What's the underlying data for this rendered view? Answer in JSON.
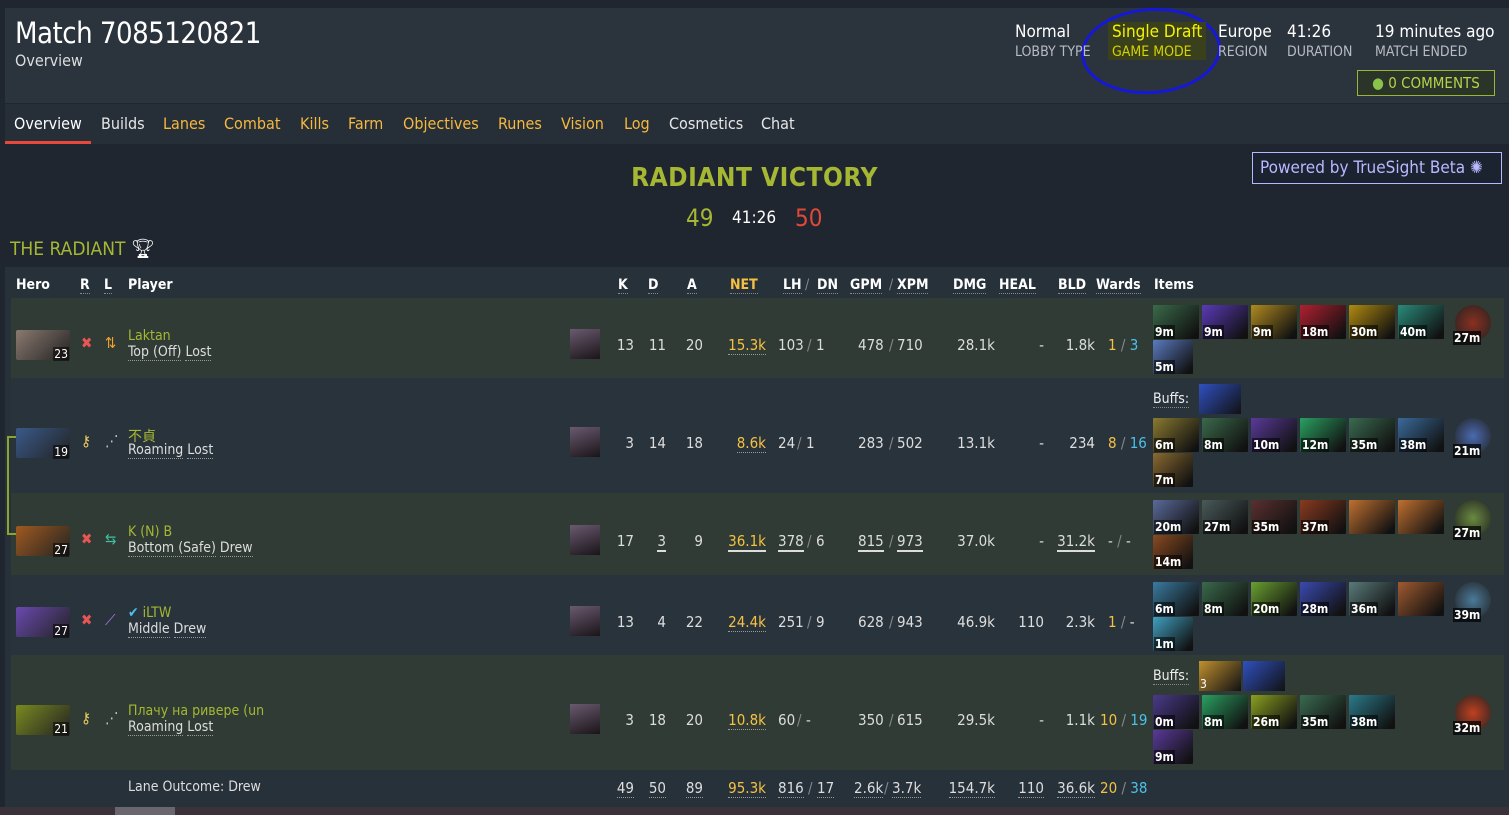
{
  "header": {
    "title": "Match 7085120821",
    "subtitle": "Overview",
    "meta": [
      {
        "value": "Normal",
        "label": "LOBBY TYPE"
      },
      {
        "value": "Single Draft",
        "label": "GAME MODE",
        "highlighted": true
      },
      {
        "value": "Europe",
        "label": "REGION"
      },
      {
        "value": "41:26",
        "label": "DURATION"
      },
      {
        "value": "19 minutes ago",
        "label": "MATCH ENDED"
      }
    ],
    "comments": "0 COMMENTS",
    "annotation_color": "#1518d8"
  },
  "tabs": [
    {
      "label": "Overview",
      "active": true
    },
    {
      "label": "Builds"
    },
    {
      "label": "Lanes"
    },
    {
      "label": "Combat"
    },
    {
      "label": "Kills"
    },
    {
      "label": "Farm"
    },
    {
      "label": "Objectives"
    },
    {
      "label": "Runes"
    },
    {
      "label": "Vision"
    },
    {
      "label": "Log"
    },
    {
      "label": "Cosmetics"
    },
    {
      "label": "Chat"
    }
  ],
  "truesight": "Powered by TrueSight Beta",
  "result": {
    "title": "RADIANT VICTORY",
    "radiant_score": "49",
    "duration": "41:26",
    "dire_score": "50"
  },
  "team": {
    "name": "THE RADIANT",
    "icon": "trophy-icon"
  },
  "columns": {
    "hero": "Hero",
    "r": "R",
    "l": "L",
    "player": "Player",
    "k": "K",
    "d": "D",
    "a": "A",
    "net": "NET",
    "lh": "LH",
    "dn": "DN",
    "gpm": "GPM",
    "xpm": "XPM",
    "dmg": "DMG",
    "heal": "HEAL",
    "bld": "BLD",
    "wards": "Wards",
    "items": "Items",
    "sep": "/"
  },
  "buffs_label": "Buffs:",
  "players": [
    {
      "level": "23",
      "hero_color": "#8a7a70",
      "role": "core",
      "lane_icon": "top-off",
      "name": "Laktan",
      "lane": "Top (Off)",
      "outcome": "Lost",
      "k": "13",
      "d": "11",
      "a": "20",
      "net": "15.3k",
      "lh": "103",
      "dn": "1",
      "gpm": "478",
      "xpm": "710",
      "dmg": "28.1k",
      "heal": "-",
      "bld": "1.8k",
      "obs": "1",
      "sen": "3",
      "best": [],
      "items": [
        {
          "t": "9m",
          "c": "#3a6a4a"
        },
        {
          "t": "9m",
          "c": "#5a3ab8"
        },
        {
          "t": "9m",
          "c": "#b08a20"
        },
        {
          "t": "18m",
          "c": "#b02030"
        },
        {
          "t": "30m",
          "c": "#b08a10"
        },
        {
          "t": "40m",
          "c": "#2a8a7a"
        }
      ],
      "neutral": {
        "t": "27m",
        "c": "#8a3020"
      },
      "extra": [
        {
          "t": "5m",
          "c": "#5a7ac0"
        }
      ],
      "buffs": []
    },
    {
      "level": "19",
      "hero_color": "#3a5a8a",
      "role": "support",
      "lane_icon": "roaming",
      "name": "不貞",
      "lane": "Roaming",
      "outcome": "Lost",
      "k": "3",
      "d": "14",
      "a": "18",
      "net": "8.6k",
      "lh": "24",
      "dn": "1",
      "gpm": "283",
      "xpm": "502",
      "dmg": "13.1k",
      "heal": "-",
      "bld": "234",
      "obs": "8",
      "sen": "16",
      "best": [],
      "items": [
        {
          "t": "6m",
          "c": "#8a7a30"
        },
        {
          "t": "8m",
          "c": "#3a6a4a"
        },
        {
          "t": "10m",
          "c": "#5a3a9a"
        },
        {
          "t": "12m",
          "c": "#2aa060"
        },
        {
          "t": "35m",
          "c": "#3a6a50"
        },
        {
          "t": "38m",
          "c": "#3a6a9a"
        }
      ],
      "neutral": {
        "t": "21m",
        "c": "#4a6ab0"
      },
      "extra": [
        {
          "t": "7m",
          "c": "#8a6a30"
        }
      ],
      "buffs": [
        {
          "t": "",
          "c": "#3050c0"
        }
      ]
    },
    {
      "level": "27",
      "hero_color": "#a05a20",
      "role": "core",
      "lane_icon": "bottom-safe",
      "name": "K (N) B",
      "lane": "Bottom (Safe)",
      "outcome": "Drew",
      "k": "17",
      "d": "3",
      "a": "9",
      "net": "36.1k",
      "lh": "378",
      "dn": "6",
      "gpm": "815",
      "xpm": "973",
      "dmg": "37.0k",
      "heal": "-",
      "bld": "31.2k",
      "obs": "-",
      "sen": "-",
      "best": [
        "d",
        "net",
        "lh",
        "gpm",
        "xpm",
        "bld"
      ],
      "items": [
        {
          "t": "20m",
          "c": "#5a6a9a"
        },
        {
          "t": "27m",
          "c": "#4a5a5a"
        },
        {
          "t": "35m",
          "c": "#5a3030"
        },
        {
          "t": "37m",
          "c": "#8a3a20"
        },
        {
          "t": "",
          "c": "#c07030"
        },
        {
          "t": "",
          "c": "#c07030"
        }
      ],
      "neutral": {
        "t": "27m",
        "c": "#6a8a40"
      },
      "extra": [
        {
          "t": "14m",
          "c": "#8a4a20"
        }
      ],
      "buffs": []
    },
    {
      "level": "27",
      "hero_color": "#6a4ab0",
      "role": "core",
      "lane_icon": "middle",
      "name": "iLTW",
      "verified": true,
      "lane": "Middle",
      "outcome": "Drew",
      "k": "13",
      "d": "4",
      "a": "22",
      "net": "24.4k",
      "lh": "251",
      "dn": "9",
      "gpm": "628",
      "xpm": "943",
      "dmg": "46.9k",
      "heal": "110",
      "bld": "2.3k",
      "obs": "1",
      "sen": "-",
      "best": [],
      "items": [
        {
          "t": "6m",
          "c": "#3a7aa0"
        },
        {
          "t": "8m",
          "c": "#3a6a4a"
        },
        {
          "t": "20m",
          "c": "#6aa030"
        },
        {
          "t": "28m",
          "c": "#3a4ab0"
        },
        {
          "t": "36m",
          "c": "#5a7a7a"
        },
        {
          "t": "",
          "c": "#a05a30"
        }
      ],
      "neutral": {
        "t": "39m",
        "c": "#4a7a9a"
      },
      "extra": [
        {
          "t": "1m",
          "c": "#40a0c0"
        }
      ],
      "buffs": []
    },
    {
      "level": "21",
      "hero_color": "#7a8a20",
      "role": "support",
      "lane_icon": "roaming",
      "name": "Плачу на ривере (un",
      "lane": "Roaming",
      "outcome": "Lost",
      "k": "3",
      "d": "18",
      "a": "20",
      "net": "10.8k",
      "lh": "60",
      "dn": "-",
      "gpm": "350",
      "xpm": "615",
      "dmg": "29.5k",
      "heal": "-",
      "bld": "1.1k",
      "obs": "10",
      "sen": "19",
      "best": [],
      "items": [
        {
          "t": "0m",
          "c": "#4a3a8a"
        },
        {
          "t": "8m",
          "c": "#2aa060"
        },
        {
          "t": "26m",
          "c": "#8aa020"
        },
        {
          "t": "35m",
          "c": "#3a6a50"
        },
        {
          "t": "38m",
          "c": "#2a7a8a"
        }
      ],
      "neutral": {
        "t": "32m",
        "c": "#c04020"
      },
      "extra": [
        {
          "t": "9m",
          "c": "#5a3a9a"
        }
      ],
      "buffs": [
        {
          "t": "3",
          "c": "#c09030"
        },
        {
          "t": "",
          "c": "#3050c0"
        }
      ]
    }
  ],
  "footer": {
    "lane_outcome": "Lane Outcome: Drew",
    "k": "49",
    "d": "50",
    "a": "89",
    "net": "95.3k",
    "lh": "816",
    "dn": "17",
    "gpm": "2.6k",
    "xpm": "3.7k",
    "dmg": "154.7k",
    "heal": "110",
    "bld": "36.6k",
    "obs": "20",
    "sen": "38"
  }
}
